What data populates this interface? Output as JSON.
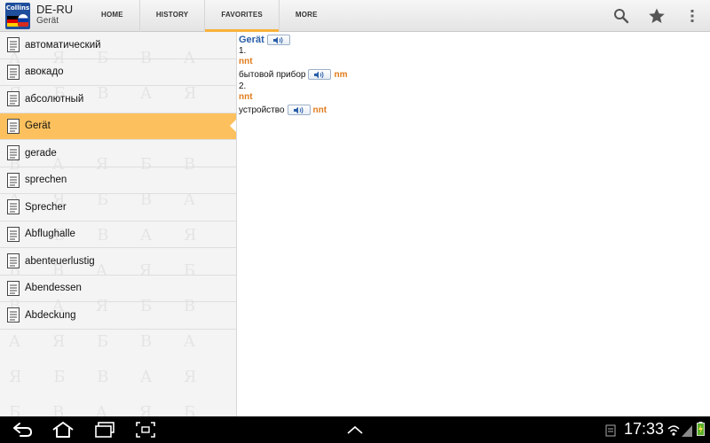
{
  "app": {
    "icon_brand": "Collins",
    "title": "DE-RU",
    "subtitle": "Gerät"
  },
  "tabs": [
    {
      "label": "HOME",
      "active": false
    },
    {
      "label": "HISTORY",
      "active": false
    },
    {
      "label": "FAVORITES",
      "active": true
    },
    {
      "label": "MORE",
      "active": false
    }
  ],
  "actions": {
    "search_icon": "search-icon",
    "favorite_icon": "star-icon",
    "overflow_icon": "overflow-menu-icon"
  },
  "list": {
    "items": [
      {
        "label": "автоматический",
        "selected": false
      },
      {
        "label": "авокадо",
        "selected": false
      },
      {
        "label": "абсолютный",
        "selected": false
      },
      {
        "label": "Gerät",
        "selected": true
      },
      {
        "label": "gerade",
        "selected": false
      },
      {
        "label": "sprechen",
        "selected": false
      },
      {
        "label": "Sprecher",
        "selected": false
      },
      {
        "label": "Abflughalle",
        "selected": false
      },
      {
        "label": "abenteuerlustig",
        "selected": false
      },
      {
        "label": "Abendessen",
        "selected": false
      },
      {
        "label": "Abdeckung",
        "selected": false
      }
    ]
  },
  "article": {
    "headword": "Gerät",
    "sense1": {
      "number": "1.",
      "gram": "nnt",
      "translation": "бытовой прибор",
      "translation_gram": "nm"
    },
    "sense2": {
      "number": "2.",
      "gram": "nnt",
      "translation": "устройство",
      "translation_gram": "nnt"
    }
  },
  "status": {
    "time": "17:33"
  },
  "colors": {
    "accent": "#f7b13b",
    "selected_row": "#fcc15e",
    "headword": "#2a5ea8",
    "grammar": "#e07b1b"
  }
}
